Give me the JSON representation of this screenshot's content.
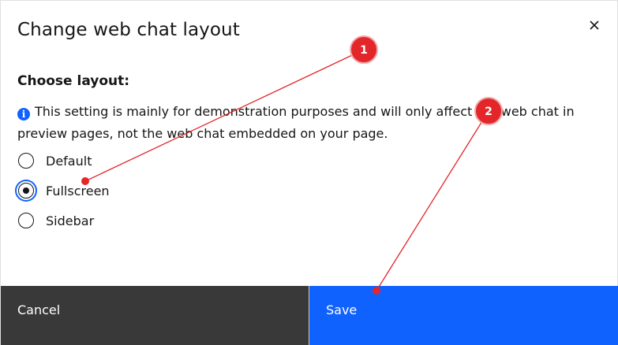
{
  "dialog": {
    "title": "Change web chat layout",
    "close_icon": "close-icon"
  },
  "layout": {
    "heading": "Choose layout:",
    "info_icon": "info-icon",
    "info_text": "This setting is mainly for demonstration purposes and will only affect the web chat in preview pages, not the web chat embedded on your page.",
    "options": [
      {
        "label": "Default",
        "checked": false
      },
      {
        "label": "Fullscreen",
        "checked": true
      },
      {
        "label": "Sidebar",
        "checked": false
      }
    ]
  },
  "footer": {
    "cancel_label": "Cancel",
    "save_label": "Save"
  },
  "annotations": {
    "marker_color": "#e3262a",
    "markers": [
      {
        "number": "1"
      },
      {
        "number": "2"
      }
    ]
  },
  "colors": {
    "primary": "#0f62fe",
    "secondary": "#393939",
    "text": "#161616"
  }
}
